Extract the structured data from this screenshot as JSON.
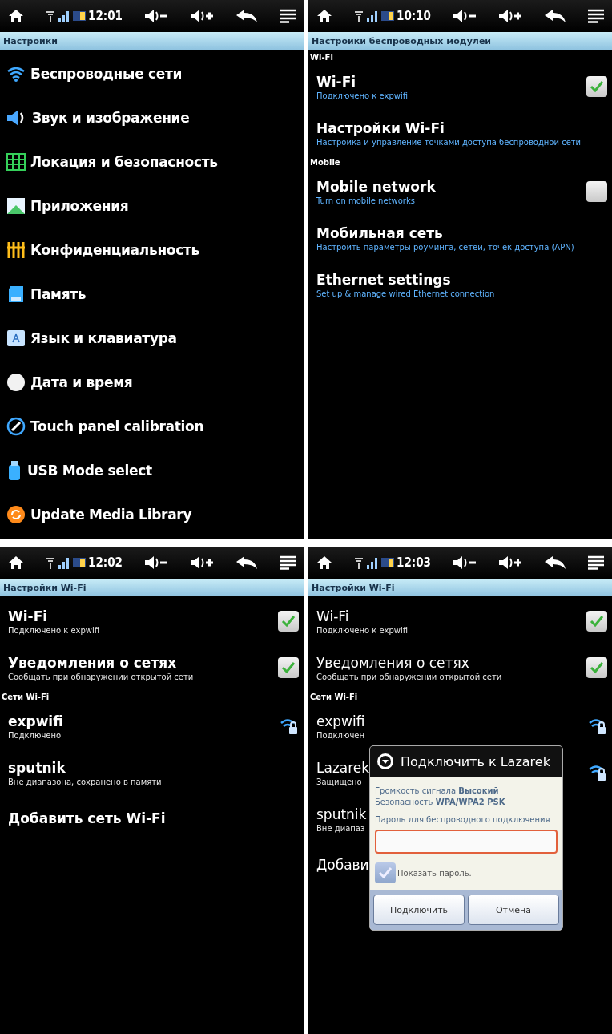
{
  "screens": [
    {
      "status_bar": {
        "time": "12:01"
      },
      "title": "Настройки",
      "items": [
        {
          "kind": "category",
          "title": "Беспроводные сети"
        },
        {
          "kind": "category",
          "title": "Звук и изображение"
        },
        {
          "kind": "category",
          "title": "Локация и безопасность"
        },
        {
          "kind": "category",
          "title": "Приложения"
        },
        {
          "kind": "category",
          "title": "Конфиденциальность"
        },
        {
          "kind": "category",
          "title": "Память"
        },
        {
          "kind": "category",
          "title": "Язык и клавиатура"
        },
        {
          "kind": "category",
          "title": "Дата и время"
        },
        {
          "kind": "category",
          "title": "Touch panel calibration"
        },
        {
          "kind": "category",
          "title": "USB Mode select"
        },
        {
          "kind": "category",
          "title": "Update Media Library"
        }
      ]
    },
    {
      "status_bar": {
        "time": "10:10"
      },
      "title": "Настройки беспроводных модулей",
      "items": [
        {
          "kind": "header",
          "title": "Wi-Fi"
        },
        {
          "kind": "toggle",
          "title": "Wi-Fi",
          "summary": "Подключено к expwifi",
          "checked": true
        },
        {
          "kind": "link",
          "title": "Настройки Wi-Fi",
          "summary": "Настройка и управление точками доступа беспроводной сети"
        },
        {
          "kind": "header",
          "title": "Mobile"
        },
        {
          "kind": "toggle",
          "title": "Mobile network",
          "summary": "Turn on mobile networks",
          "checked": false
        },
        {
          "kind": "link",
          "title": "Мобильная сеть",
          "summary": "Настроить параметры роуминга, сетей, точек доступа (APN)"
        },
        {
          "kind": "link",
          "title": "Ethernet settings",
          "summary": "Set up & manage wired Ethernet connection"
        }
      ]
    },
    {
      "status_bar": {
        "time": "12:02"
      },
      "title": "Настройки Wi-Fi",
      "items": [
        {
          "kind": "toggle",
          "title": "Wi-Fi",
          "summary": "Подключено к expwifi",
          "checked": true
        },
        {
          "kind": "toggle",
          "title": "Уведомления о сетях",
          "summary": "Сообщать при обнаружении открытой сети",
          "checked": true
        },
        {
          "kind": "header",
          "title": "Сети Wi-Fi"
        },
        {
          "kind": "network",
          "title": "expwifi",
          "summary": "Подключено",
          "in_range": true
        },
        {
          "kind": "network",
          "title": "sputnik",
          "summary": "Вне диапазона, сохранено в памяти",
          "in_range": false
        },
        {
          "kind": "link",
          "title": "Добавить сеть Wi-Fi"
        }
      ]
    },
    {
      "status_bar": {
        "time": "12:03"
      },
      "title": "Настройки Wi-Fi",
      "items": [
        {
          "kind": "toggle",
          "title": "Wi-Fi",
          "summary": "Подключено к expwifi",
          "checked": true
        },
        {
          "kind": "toggle",
          "title": "Уведомления о сетях",
          "summary": "Сообщать при обнаружении открытой сети",
          "checked": true
        },
        {
          "kind": "header",
          "title": "Сети Wi-Fi"
        },
        {
          "kind": "network",
          "title": "expwifi",
          "summary": "Подключен",
          "in_range": true
        },
        {
          "kind": "network",
          "title": "Lazarek",
          "summary": "Защищено",
          "in_range": true
        },
        {
          "kind": "network",
          "title": "sputnik",
          "summary": "Вне диапаз",
          "in_range": false
        },
        {
          "kind": "link",
          "title": "Добави"
        }
      ],
      "dialog": {
        "title": "Подключить к Lazarek",
        "rows": [
          {
            "label": "Громкость сигнала",
            "value": "Высокий"
          },
          {
            "label": "Безопасность",
            "value": "WPA/WPA2 PSK"
          }
        ],
        "password_label": "Пароль для беспроводного подключения",
        "show_password": {
          "label": "Показать пароль.",
          "checked": true
        },
        "buttons": [
          "Подключить",
          "Отмена"
        ]
      }
    }
  ]
}
